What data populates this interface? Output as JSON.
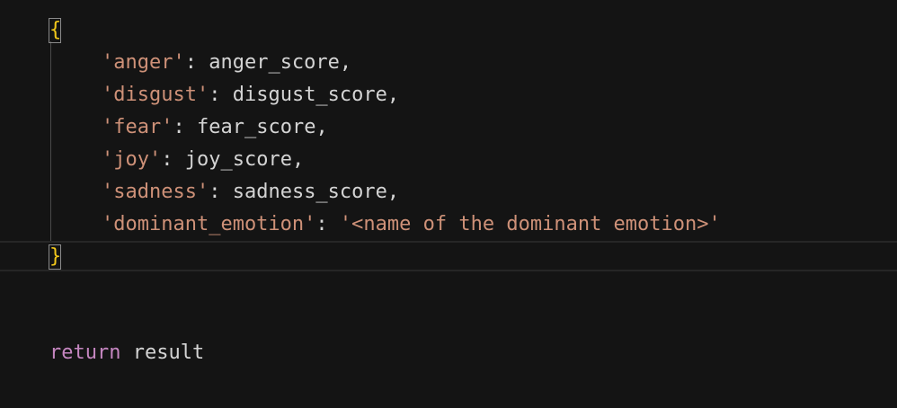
{
  "code": {
    "open_brace": "{",
    "close_brace": "}",
    "entries": [
      {
        "key": "'anger'",
        "sep": ": ",
        "value": "anger_score",
        "trail": ","
      },
      {
        "key": "'disgust'",
        "sep": ": ",
        "value": "disgust_score",
        "trail": ","
      },
      {
        "key": "'fear'",
        "sep": ": ",
        "value": "fear_score",
        "trail": ","
      },
      {
        "key": "'joy'",
        "sep": ": ",
        "value": "joy_score",
        "trail": ","
      },
      {
        "key": "'sadness'",
        "sep": ": ",
        "value": "sadness_score",
        "trail": ","
      }
    ],
    "last_entry": {
      "key": "'dominant_emotion'",
      "sep": ": ",
      "value": "'<name of the dominant emotion>'"
    },
    "return_keyword": "return",
    "return_value": "result"
  },
  "colors": {
    "background": "#141414",
    "string": "#ce9178",
    "identifier": "#d4d4d4",
    "keyword": "#c586c0",
    "bracket": "#f2c81a"
  }
}
